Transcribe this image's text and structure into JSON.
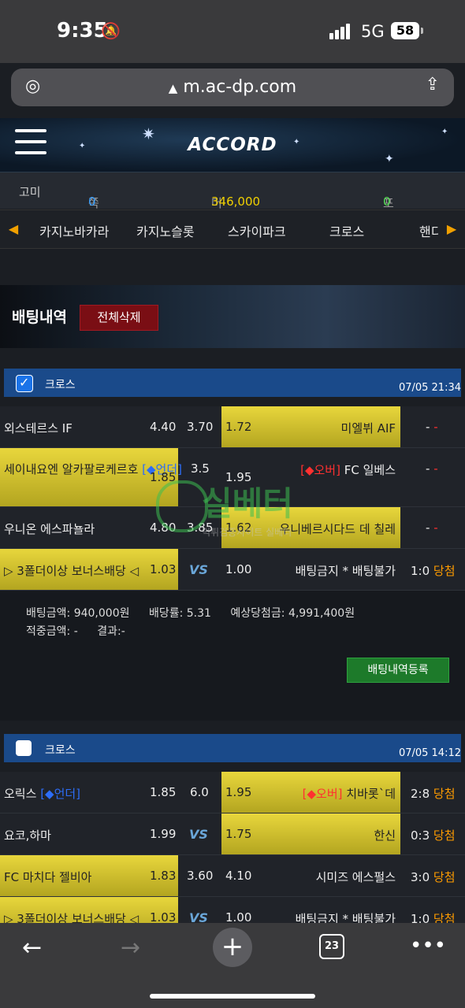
{
  "status": {
    "time": "9:35",
    "network": "5G",
    "battery": "58"
  },
  "browser": {
    "url": "m.ac-dp.com",
    "tab_count": "23"
  },
  "site": {
    "logo": "ACCORD"
  },
  "info": {
    "user": "고미",
    "notes_label": "쪽지",
    "notes_count": "0",
    "money_label": "머니",
    "money_value": "346,000",
    "points_label": "포인트",
    "points_value": "0"
  },
  "tabs": [
    "카지노바카라",
    "카지노슬롯",
    "스카이파크",
    "크로스",
    "핸디"
  ],
  "banner": {
    "title": "배팅내역",
    "delete_all": "전체삭제"
  },
  "bets": [
    {
      "type": "크로스",
      "checked": true,
      "datetime": "07/05 21:34",
      "rows": [
        {
          "home": "외스테르스 IF",
          "home_odds": "4.40",
          "mid": "3.70",
          "away_odds": "1.72",
          "away": "미엘뷔 AIF",
          "score": "-",
          "result": "-"
        },
        {
          "home": "세이내요엔 알카팔로케르호",
          "home_tag": "[◆언더]",
          "home_odds": "1.85",
          "mid": "3.5",
          "away_odds": "1.95",
          "away_tag": "[◆오버]",
          "away": "FC 일베스",
          "score": "-",
          "result": "-"
        },
        {
          "home": "우니온 에스파뇰라",
          "home_odds": "4.80",
          "mid": "3.85",
          "away_odds": "1.62",
          "away": "우니베르시다드 데 칠레",
          "score": "-",
          "result": "-"
        },
        {
          "home": "▷ 3폴더이상 보너스배당 ◁",
          "home_odds": "1.03",
          "mid": "VS",
          "away_odds": "1.00",
          "away": "배팅금지 * 배팅불가",
          "score": "1:0",
          "result": "당첨"
        }
      ],
      "summary": {
        "bet_amount_label": "배팅금액:",
        "bet_amount": "940,000원",
        "odds_label": "배당률:",
        "odds": "5.31",
        "expected_label": "예상당첨금:",
        "expected": "4,991,400원",
        "hit_label": "적중금액:",
        "hit": "-",
        "result_label": "결과:",
        "result": "-"
      },
      "register": "배팅내역등록"
    },
    {
      "type": "크로스",
      "checked": false,
      "datetime": "07/05 14:12",
      "rows": [
        {
          "home": "오릭스",
          "home_tag": "[◆언더]",
          "home_odds": "1.85",
          "mid": "6.0",
          "away_odds": "1.95",
          "away_tag": "[◆오버]",
          "away": "치바롯`데",
          "score": "2:8",
          "result": "당첨"
        },
        {
          "home": "요코,하마",
          "home_odds": "1.99",
          "mid": "VS",
          "away_odds": "1.75",
          "away": "한신",
          "score": "0:3",
          "result": "당첨"
        },
        {
          "home": "FC 마치다 젤비아",
          "home_odds": "1.83",
          "mid": "3.60",
          "away_odds": "4.10",
          "away": "시미즈 에스펄스",
          "score": "3:0",
          "result": "당첨"
        },
        {
          "home": "▷ 3폴더이상 보너스배당 ◁",
          "home_odds": "1.03",
          "mid": "VS",
          "away_odds": "1.00",
          "away": "배팅금지 * 배팅불가",
          "score": "1:0",
          "result": "당첨"
        }
      ]
    }
  ],
  "watermark": {
    "text": "실베터",
    "sub": "먹튀검증사이트 실베터"
  }
}
